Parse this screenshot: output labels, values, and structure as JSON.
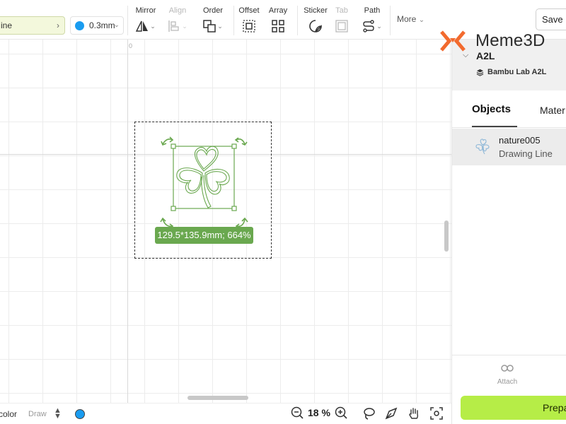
{
  "toolbar": {
    "line_value": "ine",
    "width_value": "0.3mm",
    "groups": {
      "mirror": "Mirror",
      "align": "Align",
      "order": "Order",
      "offset": "Offset",
      "array": "Array",
      "sticker": "Sticker",
      "tab": "Tab",
      "path": "Path"
    },
    "more_label": "More",
    "save_label": "Save",
    "width_color": "#1a9cf0"
  },
  "canvas": {
    "ruler_zero": "0",
    "dimension_label": "129.5*135.9mm; 664%",
    "object_color": "#6aa84f"
  },
  "bottombar": {
    "color_label": "color",
    "mode_label": "Draw",
    "zoom_value": "18 %",
    "color_swatch": "#1a9cf0"
  },
  "panel": {
    "brand_name": "Meme3D",
    "device_name": "A2L",
    "device_model": "Bambu Lab A2L",
    "tabs": [
      "Objects",
      "Mater"
    ],
    "objects": [
      {
        "name": "nature005",
        "type": "Drawing Line"
      }
    ],
    "attach_label": "Attach",
    "prepare_label": "Prepa",
    "accent_color": "#b6ed47"
  }
}
